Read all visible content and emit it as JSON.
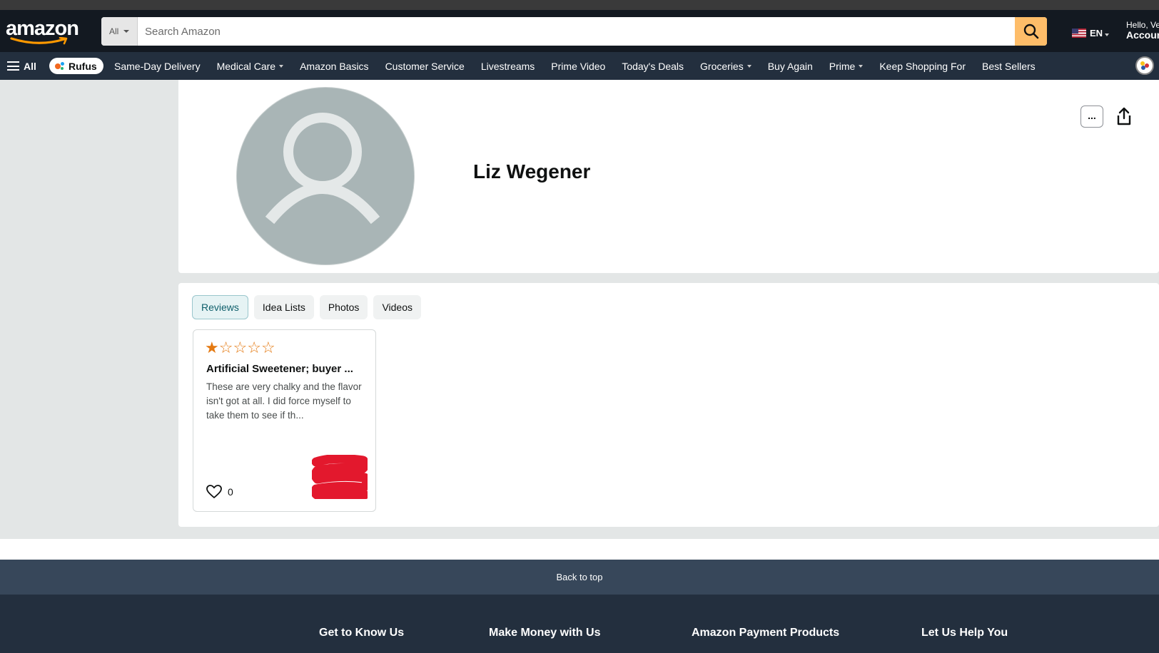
{
  "header": {
    "logo_text": "amazon",
    "search_category": "All",
    "search_placeholder": "Search Amazon",
    "language": "EN",
    "account_hello": "Hello, Ve",
    "account_main": "Accoun"
  },
  "nav": {
    "all_label": "All",
    "rufus_label": "Rufus",
    "links": [
      {
        "label": "Same-Day Delivery",
        "dropdown": false
      },
      {
        "label": "Medical Care",
        "dropdown": true
      },
      {
        "label": "Amazon Basics",
        "dropdown": false
      },
      {
        "label": "Customer Service",
        "dropdown": false
      },
      {
        "label": "Livestreams",
        "dropdown": false
      },
      {
        "label": "Prime Video",
        "dropdown": false
      },
      {
        "label": "Today's Deals",
        "dropdown": false
      },
      {
        "label": "Groceries",
        "dropdown": true
      },
      {
        "label": "Buy Again",
        "dropdown": false
      },
      {
        "label": "Prime",
        "dropdown": true
      },
      {
        "label": "Keep Shopping For",
        "dropdown": false
      },
      {
        "label": "Best Sellers",
        "dropdown": false
      }
    ]
  },
  "profile": {
    "name": "Liz Wegener",
    "more_label": "...",
    "share_icon": "share-icon"
  },
  "tabs": [
    {
      "label": "Reviews",
      "active": true
    },
    {
      "label": "Idea Lists",
      "active": false
    },
    {
      "label": "Photos",
      "active": false
    },
    {
      "label": "Videos",
      "active": false
    }
  ],
  "reviews": [
    {
      "rating": 1,
      "max_rating": 5,
      "title": "Artificial Sweetener; buyer ...",
      "body": "These are very chalky and the flavor isn't got at all. I did force myself to take them to see if th...",
      "helpful_count": "0"
    }
  ],
  "footer": {
    "back_to_top": "Back to top",
    "columns": [
      "Get to Know Us",
      "Make Money with Us",
      "Amazon Payment Products",
      "Let Us Help You"
    ]
  },
  "colors": {
    "header_bg": "#131921",
    "nav_bg": "#232f3e",
    "search_button": "#febd69",
    "star": "#e47911",
    "redaction": "#e3182d"
  }
}
